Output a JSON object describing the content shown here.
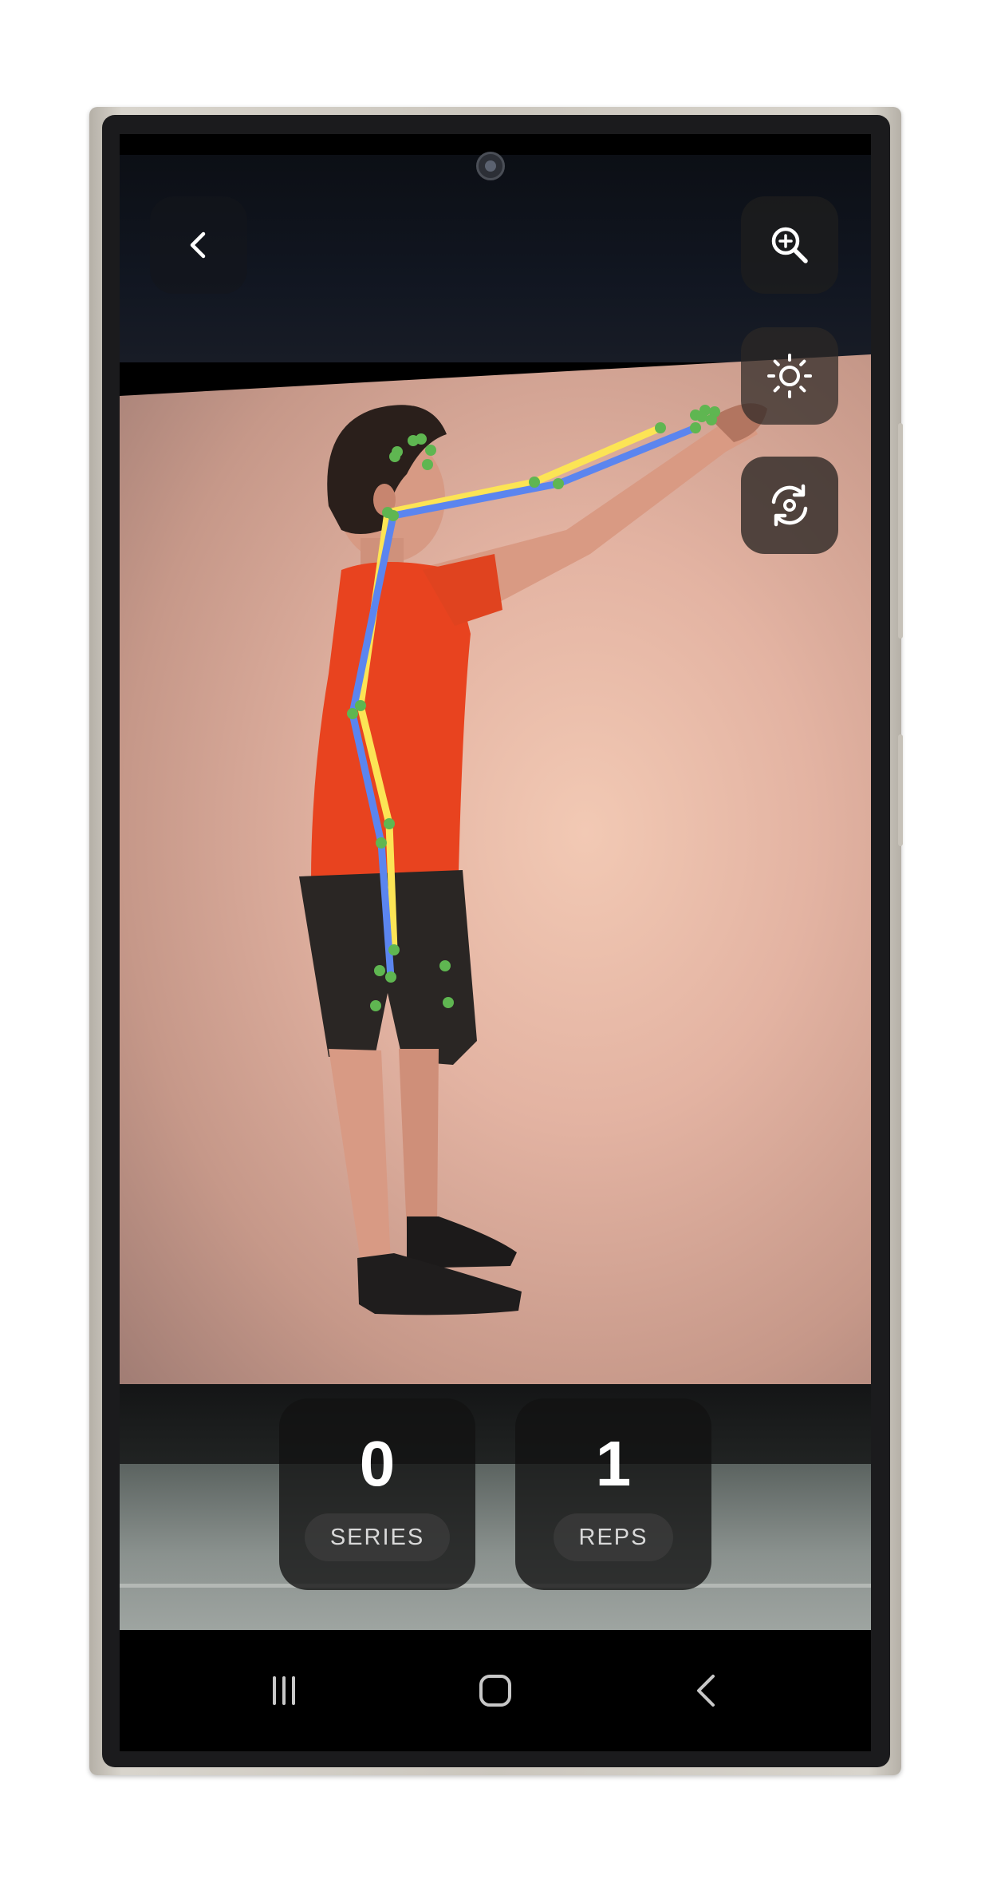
{
  "app": {
    "counters": {
      "series": {
        "value": "0",
        "label": "SERIES"
      },
      "reps": {
        "value": "1",
        "label": "REPS"
      }
    },
    "top_controls": {
      "back_icon": "chevron-left-icon",
      "zoom_icon": "zoom-in-icon",
      "exposure_icon": "brightness-icon",
      "flip_camera_icon": "camera-flip-icon"
    },
    "pose_overlay": {
      "line_colors": {
        "left_side": "#fce455",
        "right_side": "#5b85ef"
      },
      "landmark_color": "#5fb651"
    }
  },
  "system_nav": {
    "recents_icon": "recents-icon",
    "home_icon": "home-icon",
    "back_icon": "back-icon"
  },
  "colors": {
    "shirt": "#e8431f",
    "shorts": "#2a2624",
    "card_background": "#121212",
    "frame": "#cbc6bd"
  }
}
